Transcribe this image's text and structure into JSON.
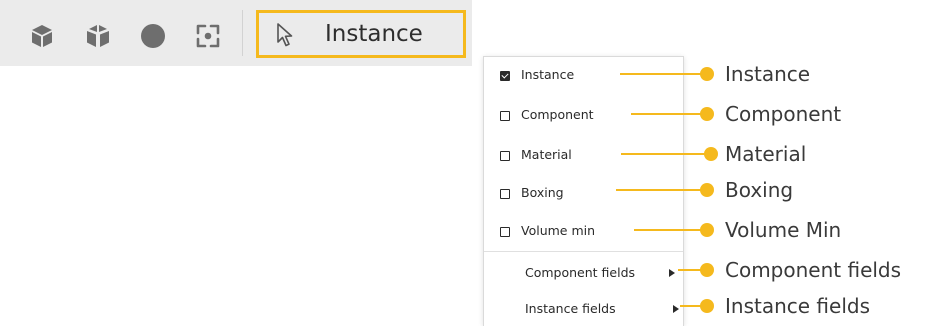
{
  "toolbar": {
    "icons": [
      "cube-icon",
      "cube-split-icon",
      "sphere-icon",
      "focus-frame-icon"
    ],
    "selection_mode": {
      "icon": "cursor-arrow-icon",
      "label": "Instance"
    }
  },
  "menu": {
    "items": [
      {
        "label": "Instance",
        "checked": true
      },
      {
        "label": "Component",
        "checked": false
      },
      {
        "label": "Material",
        "checked": false
      },
      {
        "label": "Boxing",
        "checked": false
      },
      {
        "label": "Volume min",
        "checked": false
      }
    ],
    "submenus": [
      {
        "label": "Component fields"
      },
      {
        "label": "Instance fields"
      }
    ]
  },
  "callouts": [
    "Instance",
    "Component",
    "Material",
    "Boxing",
    "Volume Min",
    "Component fields",
    "Instance fields"
  ],
  "colors": {
    "accent": "#f5b91d",
    "toolbar_bg": "#ebebeb",
    "icon_gray": "#6e6e6e"
  }
}
